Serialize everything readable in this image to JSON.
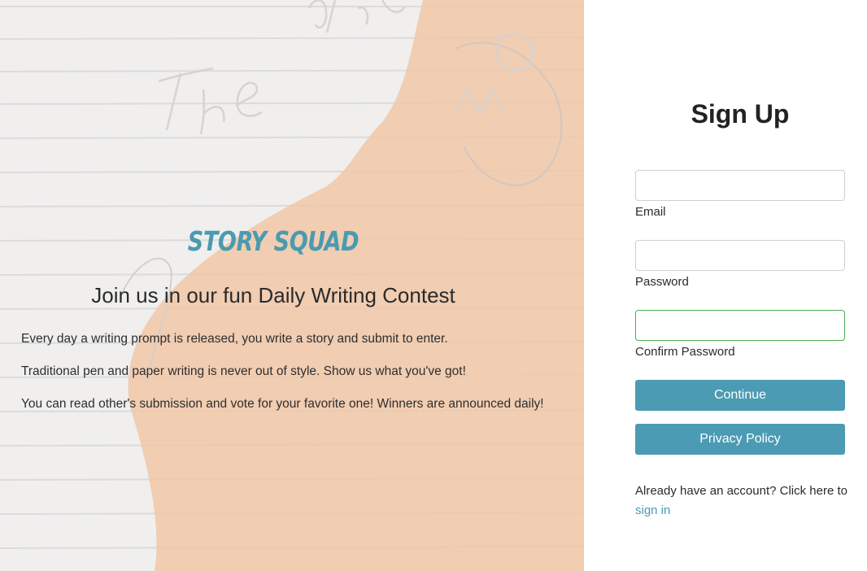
{
  "hero": {
    "brand": "Story Squad",
    "tagline": "Join us in our fun Daily Writing Contest",
    "paragraphs": [
      "Every day a writing prompt is released, you write a story and submit to enter.",
      "Traditional pen and paper writing is never out of style. Show us what you've got!",
      "You can read other's submission and vote for your favorite one! Winners are announced daily!"
    ],
    "background_art": "hand-drawn-crayon-illustration-on-lined-paper"
  },
  "signup": {
    "title": "Sign Up",
    "fields": [
      {
        "label": "Email",
        "value": "",
        "focused": false
      },
      {
        "label": "Password",
        "value": "",
        "focused": false
      },
      {
        "label": "Confirm Password",
        "value": "",
        "focused": true
      }
    ],
    "continue_label": "Continue",
    "privacy_label": "Privacy Policy",
    "signin_prompt": "Already have an account? Click here to",
    "signin_link": "sign in"
  },
  "colors": {
    "accent": "#4a9bb3",
    "brand_text": "#4a9bb0",
    "focus_border": "#4caf50",
    "hero_bg": "#efeeec",
    "crayon_orange": "#f0b88f"
  }
}
